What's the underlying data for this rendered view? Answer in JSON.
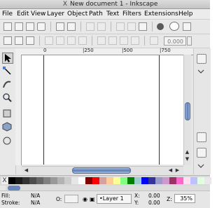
{
  "window": {
    "title": "New document 1 - Inkscape",
    "logo": "X"
  },
  "menu": [
    "File",
    "Edit",
    "View",
    "Layer",
    "Object",
    "Path",
    "Text",
    "Filters",
    "Extensions",
    "Help"
  ],
  "toolbar": {
    "zoom_value": "0.000"
  },
  "ruler": {
    "ticks": [
      "0",
      "|250",
      "|500",
      "|750"
    ]
  },
  "palette": {
    "none_label": "X",
    "colors": [
      "#000000",
      "#1a1a1a",
      "#333333",
      "#4d4d4d",
      "#666666",
      "#808080",
      "#999999",
      "#b3b3b3",
      "#cccccc",
      "#e6e6e6",
      "#ffffff",
      "#800000",
      "#ff0000",
      "#d4a0a0",
      "#ffcc99",
      "#ffff99",
      "#80ff80",
      "#008000",
      "#99cccc",
      "#0000ff",
      "#333399",
      "#9999cc",
      "#cc99cc",
      "#993366",
      "#ff66cc",
      "#ffe0f0",
      "#c0c0ff",
      "#e0ffe0",
      "#e8e8e8"
    ]
  },
  "status": {
    "fill_label": "Fill:",
    "fill_value": "N/A",
    "stroke_label": "Stroke:",
    "stroke_value": "N/A",
    "opacity_label": "O:",
    "layer": "•Layer 1",
    "x_label": "X:",
    "x_value": "0.00",
    "y_label": "Y:",
    "y_value": "0.00",
    "zoom_label": "Z:",
    "zoom_value": "35%"
  }
}
